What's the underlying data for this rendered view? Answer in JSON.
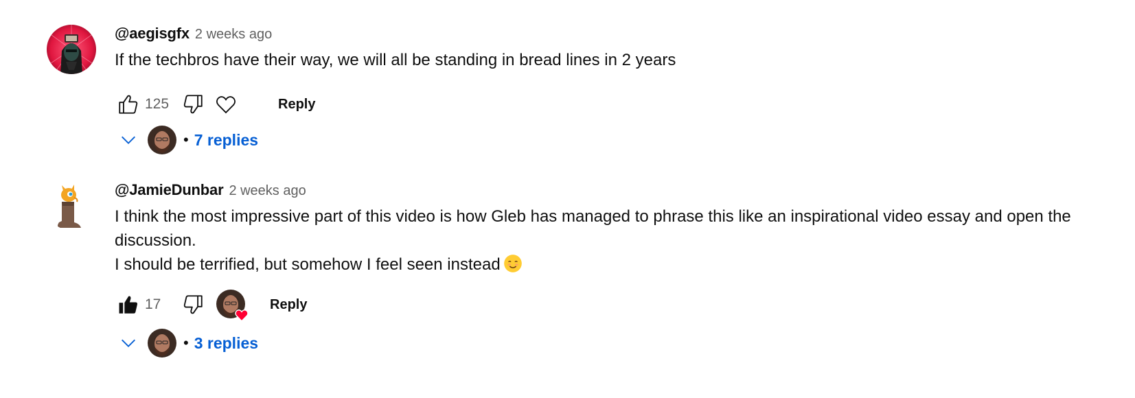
{
  "comments": [
    {
      "author": "@aegisgfx",
      "time": "2 weeks ago",
      "text_lines": [
        "If the techbros have their way, we will all be standing in bread lines in 2 years"
      ],
      "likes": "125",
      "liked": false,
      "creator_hearted": false,
      "reply_label": "Reply",
      "replies_label": "7 replies",
      "avatar_icon": "red-mask-avatar"
    },
    {
      "author": "@JamieDunbar",
      "time": "2 weeks ago",
      "text_lines": [
        "I think the most impressive part of this video is how Gleb has managed to phrase this like an inspirational video essay and open the",
        "discussion.",
        "I should be terrified, but somehow I feel seen instead"
      ],
      "likes": "17",
      "liked": true,
      "creator_hearted": true,
      "reply_label": "Reply",
      "replies_label": "3 replies",
      "avatar_icon": "dragon-in-boot-avatar"
    }
  ],
  "separator": "•",
  "colors": {
    "link_blue": "#065fd4",
    "secondary_text": "#606060",
    "heart_red": "#ff0033"
  }
}
